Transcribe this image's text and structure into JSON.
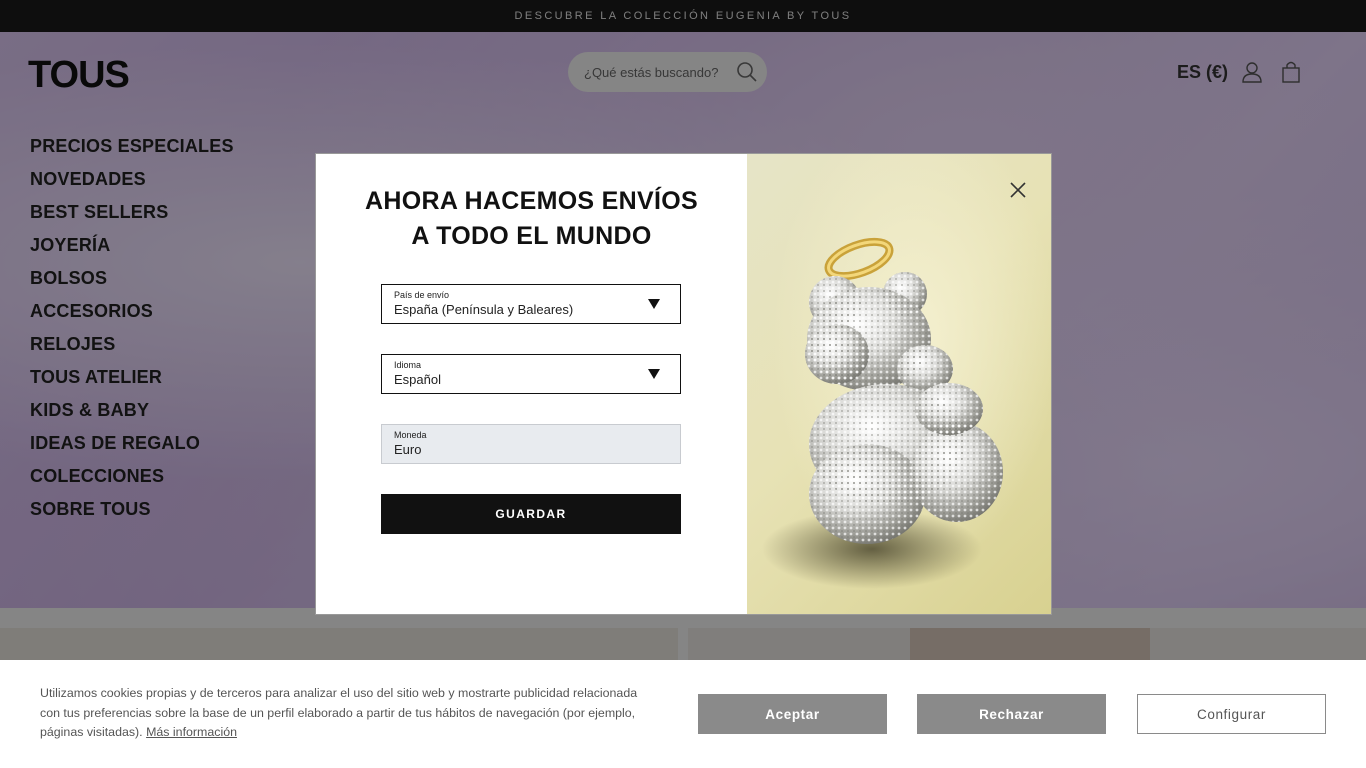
{
  "promo": {
    "text": "DESCUBRE LA COLECCIÓN EUGENIA BY TOUS"
  },
  "header": {
    "logo": "TOUS",
    "search_placeholder": "¿Qué estás buscando?",
    "locale": "ES (€)"
  },
  "nav": {
    "items": [
      "PRECIOS ESPECIALES",
      "NOVEDADES",
      "BEST SELLERS",
      "JOYERÍA",
      "BOLSOS",
      "ACCESORIOS",
      "RELOJES",
      "TOUS ATELIER",
      "KIDS & BABY",
      "IDEAS DE REGALO",
      "COLECCIONES",
      "SOBRE TOUS"
    ]
  },
  "modal": {
    "title_line1": "AHORA HACEMOS ENVÍOS",
    "title_line2": "A TODO EL MUNDO",
    "country": {
      "label": "País de envío",
      "value": "España (Península y Baleares)"
    },
    "language": {
      "label": "Idioma",
      "value": "Español"
    },
    "currency": {
      "label": "Moneda",
      "value": "Euro"
    },
    "save_label": "GUARDAR"
  },
  "cookie": {
    "text": "Utilizamos cookies propias y de terceros para analizar el uso del sitio web y mostrarte publicidad relacionada con tus preferencias sobre la base de un perfil elaborado a partir de tus hábitos de navegación (por ejemplo, páginas visitadas).",
    "more_link": "Más información",
    "accept_label": "Aceptar",
    "reject_label": "Rechazar",
    "configure_label": "Configurar"
  },
  "colors": {
    "overlay": "rgba(0,0,0,0.45)",
    "button_dark": "#111111",
    "button_grey": "#8a8a8a"
  }
}
